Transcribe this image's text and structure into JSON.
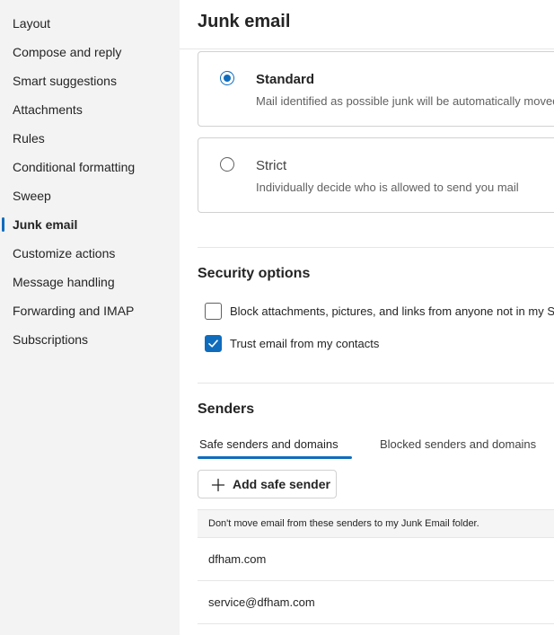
{
  "sidebar": {
    "items": [
      {
        "label": "Layout"
      },
      {
        "label": "Compose and reply"
      },
      {
        "label": "Smart suggestions"
      },
      {
        "label": "Attachments"
      },
      {
        "label": "Rules"
      },
      {
        "label": "Conditional formatting"
      },
      {
        "label": "Sweep"
      },
      {
        "label": "Junk email",
        "active": true
      },
      {
        "label": "Customize actions"
      },
      {
        "label": "Message handling"
      },
      {
        "label": "Forwarding and IMAP"
      },
      {
        "label": "Subscriptions"
      }
    ]
  },
  "main": {
    "title": "Junk email",
    "filter_options": [
      {
        "title": "Standard",
        "description": "Mail identified as possible junk will be automatically moved to the Junk Email folder.",
        "selected": true
      },
      {
        "title": "Strict",
        "description": "Individually decide who is allowed to send you mail",
        "selected": false
      }
    ],
    "security": {
      "title": "Security options",
      "options": [
        {
          "label": "Block attachments, pictures, and links from anyone not in my Safe senders and domains list",
          "checked": false
        },
        {
          "label": "Trust email from my contacts",
          "checked": true
        }
      ]
    },
    "senders": {
      "title": "Senders",
      "tabs": [
        {
          "label": "Safe senders and domains",
          "active": true
        },
        {
          "label": "Blocked senders and domains",
          "active": false
        }
      ],
      "add_button_label": "Add safe sender",
      "list_header": "Don't move email from these senders to my Junk Email folder.",
      "entries": [
        "dfham.com",
        "service@dfham.com"
      ]
    }
  },
  "colors": {
    "accent": "#0f6cbd",
    "sidebar_bg": "#f3f3f3"
  },
  "icons": {
    "add": "plus-icon",
    "check": "checkmark-icon"
  }
}
